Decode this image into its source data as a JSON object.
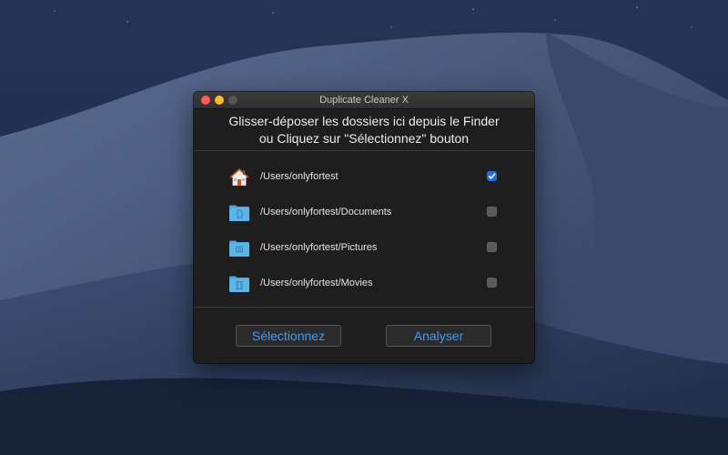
{
  "window": {
    "title": "Duplicate Cleaner X"
  },
  "header": {
    "line1": "Glisser-déposer les dossiers ici depuis le Finder",
    "line2": "ou Cliquez sur \"Sélectionnez\" bouton"
  },
  "folders": [
    {
      "path": "/Users/onlyfortest",
      "icon": "home-folder-icon",
      "checked": true
    },
    {
      "path": "/Users/onlyfortest/Documents",
      "icon": "documents-folder-icon",
      "checked": false
    },
    {
      "path": "/Users/onlyfortest/Pictures",
      "icon": "pictures-folder-icon",
      "checked": false
    },
    {
      "path": "/Users/onlyfortest/Movies",
      "icon": "movies-folder-icon",
      "checked": false
    }
  ],
  "buttons": {
    "select": "Sélectionnez",
    "analyze": "Analyser"
  },
  "colors": {
    "accent": "#3d9bff",
    "checkbox_on": "#1f6fde",
    "window_bg": "#1e1e1e",
    "folder_blue": "#5db5e6"
  }
}
